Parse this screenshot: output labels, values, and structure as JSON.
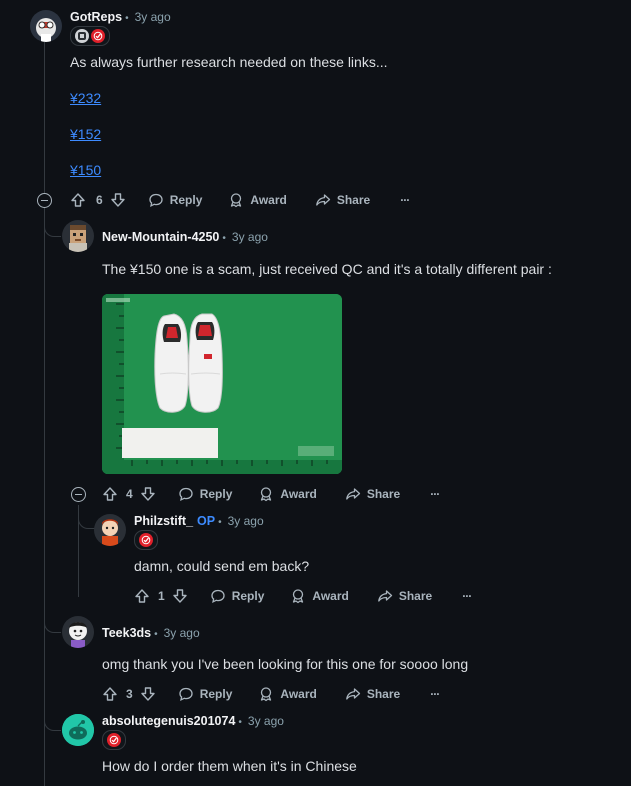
{
  "comments": {
    "c1": {
      "user": "GotReps",
      "time": "3y ago",
      "text": "As always further research needed on these links...",
      "links": [
        "¥232",
        "¥152",
        "¥150"
      ],
      "votes": "6"
    },
    "c2": {
      "user": "New-Mountain-4250",
      "time": "3y ago",
      "text": "The ¥150 one is a scam, just received QC and it's a totally different pair :",
      "votes": "4"
    },
    "c3": {
      "user": "Philzstift_",
      "op": "OP",
      "time": "3y ago",
      "text": "damn, could send em back?",
      "votes": "1"
    },
    "c4": {
      "user": "Teek3ds",
      "time": "3y ago",
      "text": "omg thank you I've been looking for this one for soooo long",
      "votes": "3"
    },
    "c5": {
      "user": "absolutegenuis201074",
      "time": "3y ago",
      "text": "How do I order them when it's in Chinese"
    }
  },
  "actions": {
    "reply": "Reply",
    "award": "Award",
    "share": "Share",
    "more": "···"
  },
  "colors": {
    "background": "#0e1116",
    "link": "#3d8bff",
    "op": "#3d8bff",
    "thread": "#343a40",
    "flair_red": "#e0202a"
  }
}
